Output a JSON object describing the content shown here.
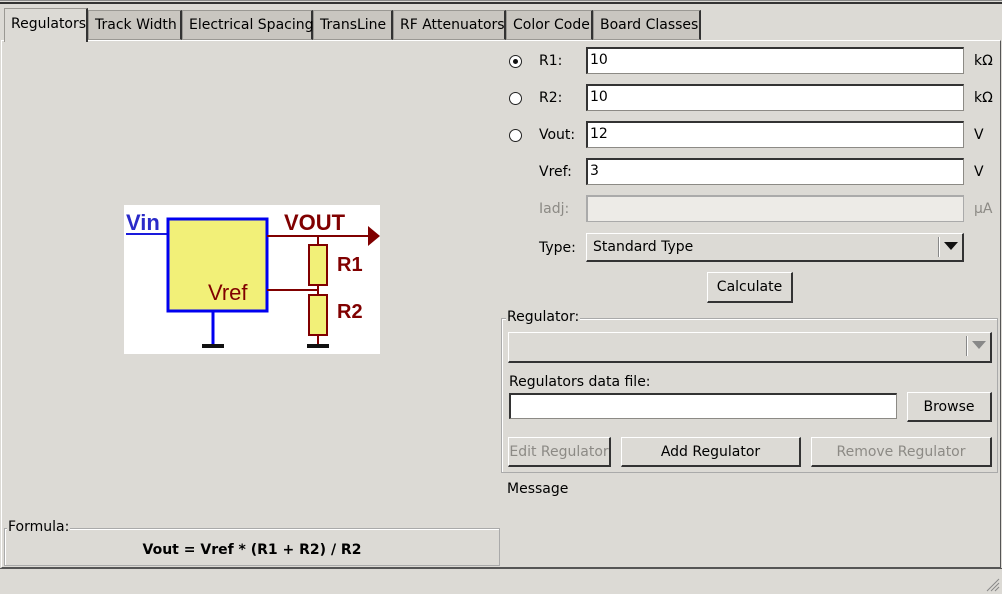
{
  "tabs": [
    {
      "label": "Regulators",
      "active": true
    },
    {
      "label": "Track Width"
    },
    {
      "label": "Electrical Spacing"
    },
    {
      "label": "TransLine"
    },
    {
      "label": "RF Attenuators"
    },
    {
      "label": "Color Code"
    },
    {
      "label": "Board Classes"
    }
  ],
  "schematic": {
    "vin": "Vin",
    "vout": "VOUT",
    "vref": "Vref",
    "r1": "R1",
    "r2": "R2"
  },
  "fields": [
    {
      "label": "R1:",
      "value": "10",
      "unit": "kΩ",
      "radio": true,
      "selected": true
    },
    {
      "label": "R2:",
      "value": "10",
      "unit": "kΩ",
      "radio": true,
      "selected": false
    },
    {
      "label": "Vout:",
      "value": "12",
      "unit": "V",
      "radio": true,
      "selected": false
    },
    {
      "label": "Vref:",
      "value": "3",
      "unit": "V"
    },
    {
      "label": "Iadj:",
      "value": "",
      "unit": "µA",
      "disabled": true
    }
  ],
  "type": {
    "label": "Type:",
    "value": "Standard Type"
  },
  "calculate_label": "Calculate",
  "regulator_group": {
    "title": "Regulator:",
    "selected": "",
    "data_file_label": "Regulators data file:",
    "data_file_value": "",
    "browse_label": "Browse",
    "edit_label": "Edit Regulator",
    "add_label": "Add Regulator",
    "remove_label": "Remove Regulator"
  },
  "message": "Message",
  "formula": {
    "title": "Formula:",
    "text": "Vout = Vref * (R1 + R2) / R2"
  }
}
